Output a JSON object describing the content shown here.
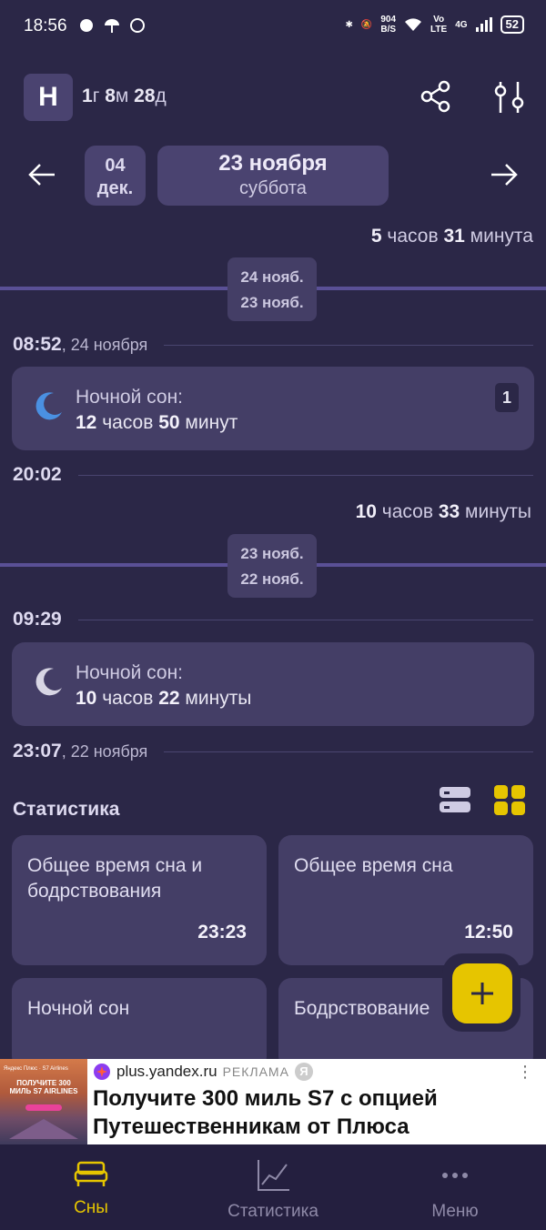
{
  "status_bar": {
    "time": "18:56",
    "net_speed_value": "904",
    "net_speed_unit": "B/S",
    "volte_top": "Vo",
    "volte_bottom": "LTE",
    "network": "4G",
    "battery": "52"
  },
  "header": {
    "badge": "Н",
    "age_parts": {
      "y_num": "1",
      "y_unit": "г",
      "m_num": "8",
      "m_unit": "м",
      "d_num": "28",
      "d_unit": "д"
    }
  },
  "date_nav": {
    "jump_day": "04",
    "jump_month": "дек.",
    "current_date": "23 ноября",
    "current_weekday": "суббота"
  },
  "timeline": {
    "gap1": {
      "h": "5",
      "h_unit": " часов ",
      "m": "31",
      "m_unit": " минута"
    },
    "chip1": {
      "top": "24 нояб.",
      "bottom": "23 нояб."
    },
    "time1": {
      "time": "08:52",
      "date": ", 24 ноября"
    },
    "sleep1": {
      "label": "Ночной сон:",
      "h": "12",
      "h_unit": " часов ",
      "m": "50",
      "m_unit": " минут",
      "count": "1"
    },
    "time2": {
      "time": "20:02"
    },
    "gap2": {
      "h": "10",
      "h_unit": " часов ",
      "m": "33",
      "m_unit": " минуты"
    },
    "chip2": {
      "top": "23 нояб.",
      "bottom": "22 нояб."
    },
    "time3": {
      "time": "09:29"
    },
    "sleep2": {
      "label": "Ночной сон:",
      "h": "10",
      "h_unit": " часов ",
      "m": "22",
      "m_unit": " минуты"
    },
    "time4": {
      "time": "23:07",
      "date": ", 22 ноября"
    }
  },
  "stats": {
    "title": "Статистика",
    "cards": [
      {
        "label": "Общее время сна и бодрствования",
        "value": "23:23"
      },
      {
        "label": "Общее время сна",
        "value": "12:50"
      },
      {
        "label": "Ночной сон",
        "value": ""
      },
      {
        "label": "Бодрствование",
        "value": ""
      }
    ]
  },
  "ad": {
    "image_brand": "Яндекс Плюс · S7 Airlines",
    "image_headline": "ПОЛУЧИТЕ 300 МИЛЬ S7 AIRLINES",
    "source": "plus.yandex.ru",
    "label": "РЕКЛАМА",
    "ya_badge": "Я",
    "headline": "Получите 300 миль S7 с опцией Путешественникам от Плюса"
  },
  "nav": {
    "sleep": "Сны",
    "stats": "Статистика",
    "menu": "Меню"
  },
  "colors": {
    "background": "#2b2747",
    "card": "#443e66",
    "accent": "#e6c500",
    "moon_active": "#4a90e2"
  }
}
